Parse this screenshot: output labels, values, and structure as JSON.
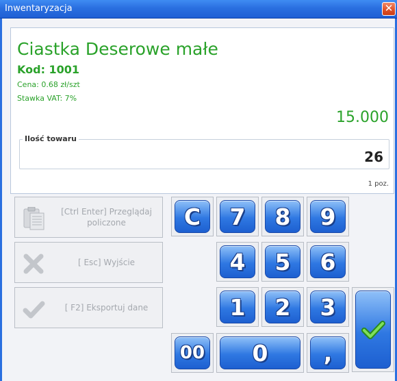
{
  "window": {
    "title": "Inwentaryzacja",
    "close_symbol": "✕"
  },
  "product": {
    "name": "Ciastka Deserowe małe",
    "code": "Kod: 1001",
    "price": "Cena: 0.68 zł/szt",
    "vat": "Stawka VAT: 7%",
    "total": "15.000"
  },
  "quantity": {
    "legend": "Ilość towaru",
    "value": "26",
    "positions": "1 poz."
  },
  "actions": {
    "browse_label": "[Ctrl Enter] Przeglądaj policzone",
    "exit_label": "[ Esc] Wyjście",
    "export_label": "[ F2] Eksportuj dane"
  },
  "keypad": {
    "clear": "C",
    "k7": "7",
    "k8": "8",
    "k9": "9",
    "k4": "4",
    "k5": "5",
    "k6": "6",
    "k1": "1",
    "k2": "2",
    "k3": "3",
    "k00": "00",
    "k0": "0",
    "comma": ","
  },
  "icons": {
    "browse": "clipboard-icon",
    "exit": "x-icon",
    "export": "check-icon",
    "confirm": "check-icon"
  },
  "colors": {
    "accent_green": "#2aa22a",
    "title_blue": "#2a6fe0",
    "key_blue": "#2f78e2"
  }
}
